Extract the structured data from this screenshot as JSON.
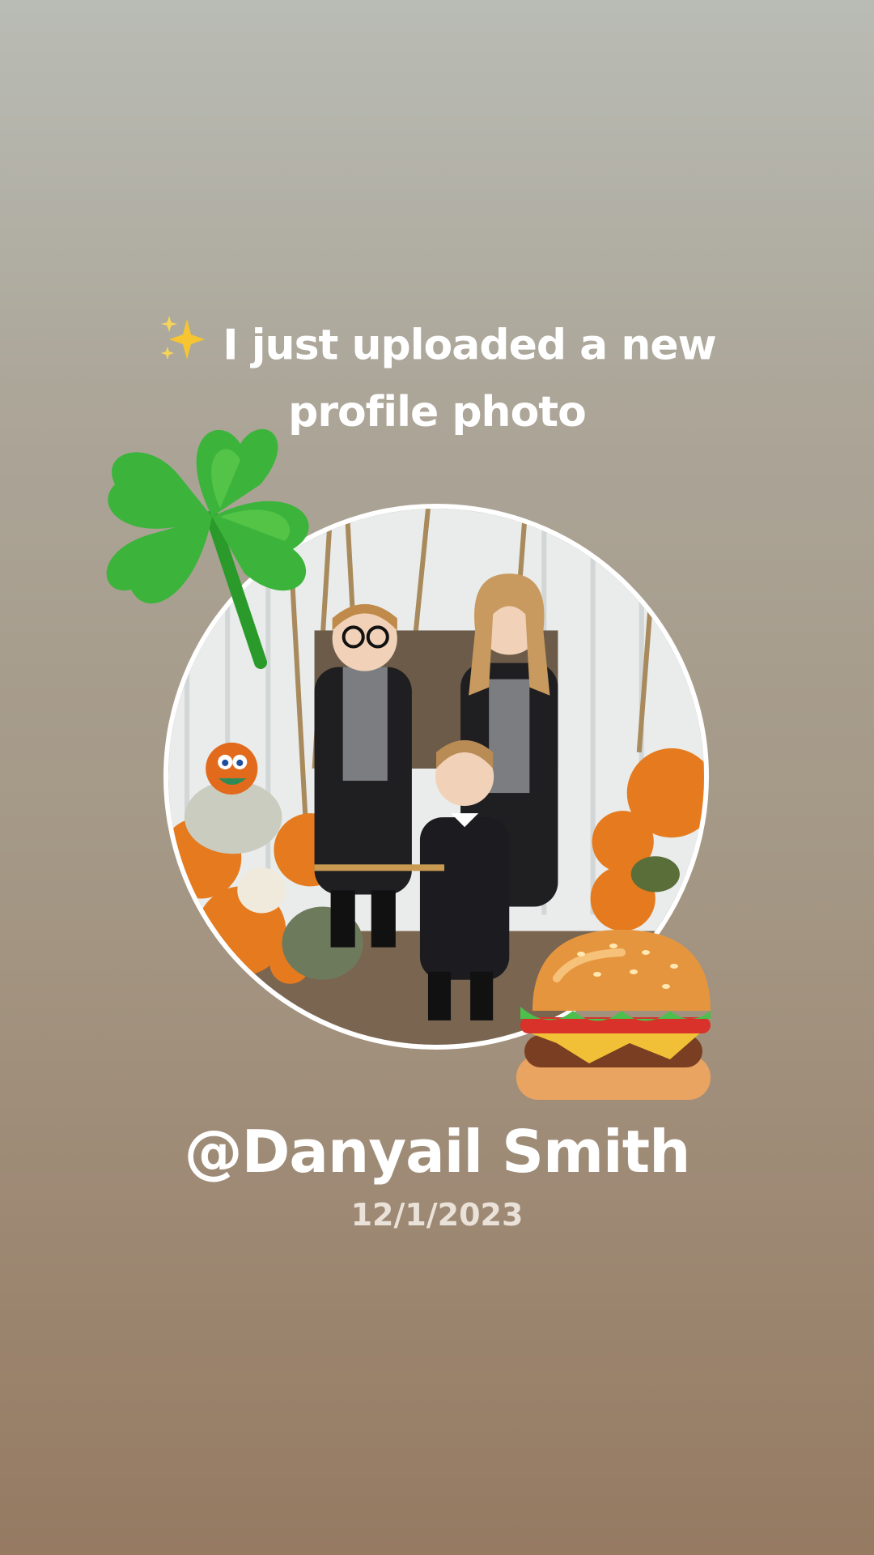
{
  "story": {
    "headline_icon": "sparkles-icon",
    "headline": "I just uploaded a new profile photo",
    "photo_subject": "profile-photo",
    "stickers": [
      "four-leaf-clover-sticker",
      "hamburger-sticker"
    ],
    "username": "@Danyail Smith",
    "date": "12/1/2023"
  }
}
